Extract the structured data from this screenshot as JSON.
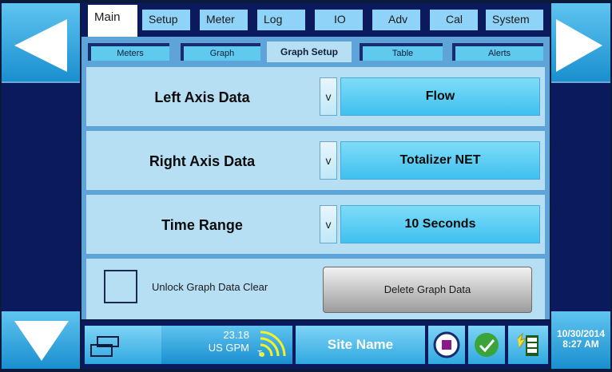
{
  "tabs": {
    "main": [
      {
        "label": "Main",
        "active": true
      },
      {
        "label": "Setup",
        "active": false
      },
      {
        "label": "Meter",
        "active": false
      },
      {
        "label": "Log",
        "active": false
      },
      {
        "label": "IO",
        "active": false
      },
      {
        "label": "Adv",
        "active": false
      },
      {
        "label": "Cal",
        "active": false
      },
      {
        "label": "System",
        "active": false
      }
    ],
    "sub": [
      {
        "label": "Meters",
        "active": false
      },
      {
        "label": "Graph",
        "active": false
      },
      {
        "label": "Graph Setup",
        "active": true
      },
      {
        "label": "Table",
        "active": false
      },
      {
        "label": "Alerts",
        "active": false
      }
    ]
  },
  "settings": [
    {
      "label": "Left Axis Data",
      "dropdown": "v",
      "value": "Flow"
    },
    {
      "label": "Right Axis Data",
      "dropdown": "v",
      "value": "Totalizer NET"
    },
    {
      "label": "Time Range",
      "dropdown": "v",
      "value": "10 Seconds"
    }
  ],
  "unlock_label": "Unlock Graph Data Clear",
  "delete_button": "Delete Graph Data",
  "status": {
    "flow_value": "23.18",
    "flow_unit": "US GPM",
    "signal_label": "T",
    "site_name": "Site Name",
    "date": "10/30/2014",
    "time": "8:27 AM"
  },
  "colors": {
    "panel": "#5ea4d8",
    "row": "#b6dff4",
    "accent": "#3fc0ef",
    "background": "#0a1a5c"
  }
}
